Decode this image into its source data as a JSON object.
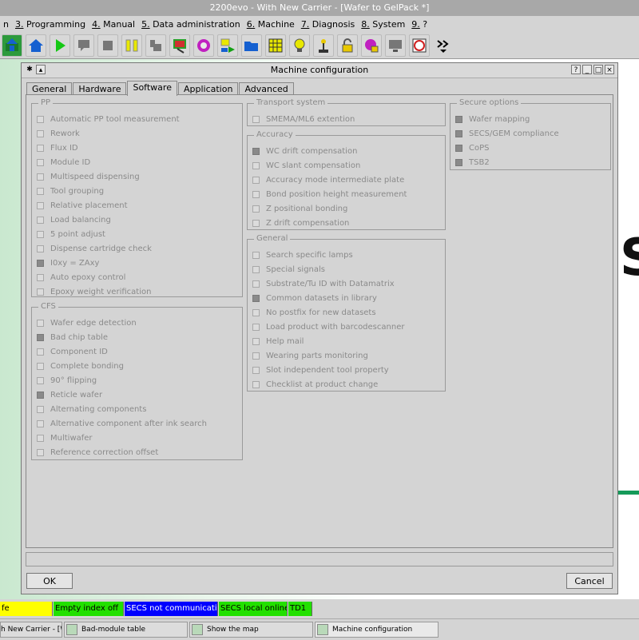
{
  "window": {
    "title": "2200evo - With New Carrier - [Wafer to GelPack *]"
  },
  "menu": [
    {
      "num": "",
      "label": "n"
    },
    {
      "num": "3.",
      "label": " Programming"
    },
    {
      "num": "4.",
      "label": " Manual"
    },
    {
      "num": "5.",
      "label": " Data administration"
    },
    {
      "num": "6.",
      "label": " Machine"
    },
    {
      "num": "7.",
      "label": " Diagnosis"
    },
    {
      "num": "8.",
      "label": " System"
    },
    {
      "num": "9.",
      "label": " ?"
    }
  ],
  "toolbar_icons": [
    "machine-icon",
    "home-icon",
    "play-icon",
    "comment-icon",
    "stop-icon",
    "pause-icon",
    "step-icon",
    "map-icon",
    "search-chip-icon",
    "load-icon",
    "open-folder-icon",
    "grid-icon",
    "lamp-icon",
    "joystick-icon",
    "lock-icon",
    "lock-chip-icon",
    "monitor-icon",
    "wafer-icon",
    "more-icon"
  ],
  "dialog": {
    "title": "Machine configuration",
    "tabs": [
      "General",
      "Hardware",
      "Software",
      "Application",
      "Advanced"
    ],
    "active_tab": "Software",
    "groups": {
      "pp": {
        "title": "PP",
        "options": [
          {
            "label": "Automatic PP tool measurement",
            "checked": false
          },
          {
            "label": "Rework",
            "checked": false
          },
          {
            "label": "Flux ID",
            "checked": false
          },
          {
            "label": "Module ID",
            "checked": false
          },
          {
            "label": "Multispeed dispensing",
            "checked": false
          },
          {
            "label": "Tool grouping",
            "checked": false
          },
          {
            "label": "Relative placement",
            "checked": false
          },
          {
            "label": "Load balancing",
            "checked": false
          },
          {
            "label": "5 point adjust",
            "checked": false
          },
          {
            "label": "Dispense cartridge check",
            "checked": false
          },
          {
            "label": "I0xy = ZAxy",
            "checked": true
          },
          {
            "label": "Auto epoxy control",
            "checked": false
          },
          {
            "label": "Epoxy weight verification",
            "checked": false
          }
        ]
      },
      "cfs": {
        "title": "CFS",
        "options": [
          {
            "label": "Wafer edge detection",
            "checked": false
          },
          {
            "label": "Bad chip table",
            "checked": true
          },
          {
            "label": "Component ID",
            "checked": false
          },
          {
            "label": "Complete bonding",
            "checked": false
          },
          {
            "label": "90° flipping",
            "checked": false
          },
          {
            "label": "Reticle wafer",
            "checked": true
          },
          {
            "label": "Alternating components",
            "checked": false
          },
          {
            "label": "Alternative component after ink search",
            "checked": false
          },
          {
            "label": "Multiwafer",
            "checked": false
          },
          {
            "label": "Reference correction offset",
            "checked": false
          }
        ]
      },
      "transport": {
        "title": "Transport system",
        "options": [
          {
            "label": "SMEMA/ML6 extention",
            "checked": false
          }
        ]
      },
      "accuracy": {
        "title": "Accuracy",
        "options": [
          {
            "label": "WC drift compensation",
            "checked": true
          },
          {
            "label": "WC slant compensation",
            "checked": false
          },
          {
            "label": "Accuracy mode intermediate plate",
            "checked": false
          },
          {
            "label": "Bond position height measurement",
            "checked": false
          },
          {
            "label": "Z positional bonding",
            "checked": false
          },
          {
            "label": "Z drift compensation",
            "checked": false
          }
        ]
      },
      "general": {
        "title": "General",
        "options": [
          {
            "label": "Search specific lamps",
            "checked": false
          },
          {
            "label": "Special signals",
            "checked": false
          },
          {
            "label": "Substrate/Tu ID with Datamatrix",
            "checked": false
          },
          {
            "label": "Common datasets in library",
            "checked": true
          },
          {
            "label": "No postfix for new datasets",
            "checked": false
          },
          {
            "label": "Load product with barcodescanner",
            "checked": false
          },
          {
            "label": "Help mail",
            "checked": false
          },
          {
            "label": "Wearing parts monitoring",
            "checked": false
          },
          {
            "label": "Slot independent tool property",
            "checked": false
          },
          {
            "label": "Checklist at product change",
            "checked": false
          }
        ]
      },
      "secure": {
        "title": "Secure options",
        "options": [
          {
            "label": "Wafer mapping",
            "checked": true
          },
          {
            "label": "SECS/GEM compliance",
            "checked": true
          },
          {
            "label": "CoPS",
            "checked": true
          },
          {
            "label": "TSB2",
            "checked": true
          }
        ]
      }
    },
    "ok_label": "OK",
    "cancel_label": "Cancel"
  },
  "status_bar": [
    {
      "text": "fe",
      "color": "#ffff00"
    },
    {
      "text": "Empty index off",
      "color": "#22e000"
    },
    {
      "text": "SECS not communicating",
      "color": "#0000ff",
      "text_color": "#ffffff"
    },
    {
      "text": "SECS local online",
      "color": "#22e000"
    },
    {
      "text": "TD1",
      "color": "#22e000"
    }
  ],
  "taskbar": [
    {
      "label": "h New Carrier - [Wa"
    },
    {
      "label": "Bad-module table"
    },
    {
      "label": "Show the map"
    },
    {
      "label": "Machine configuration"
    }
  ],
  "background": {
    "big_letter": "S"
  }
}
